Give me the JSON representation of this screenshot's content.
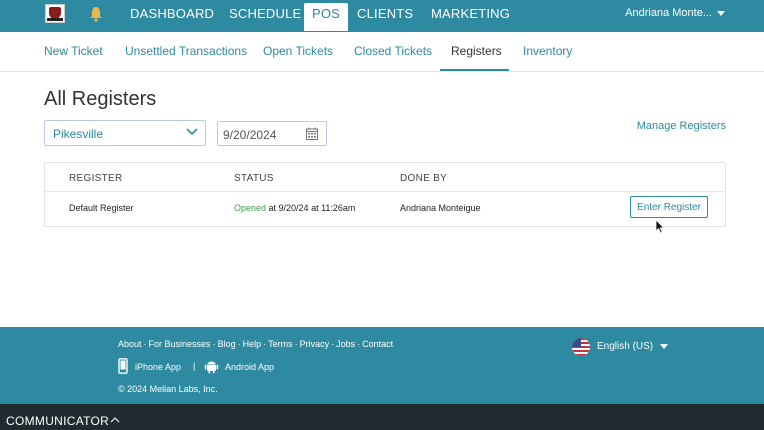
{
  "nav": {
    "items": [
      {
        "label": "DASHBOARD",
        "active": false
      },
      {
        "label": "SCHEDULE",
        "active": false
      },
      {
        "label": "POS",
        "active": true
      },
      {
        "label": "CLIENTS",
        "active": false
      },
      {
        "label": "MARKETING",
        "active": false
      }
    ],
    "user": "Andriana Monte..."
  },
  "subnav": {
    "items": [
      {
        "label": "New Ticket"
      },
      {
        "label": "Unsettled Transactions"
      },
      {
        "label": "Open Tickets"
      },
      {
        "label": "Closed Tickets"
      },
      {
        "label": "Registers",
        "active": true
      },
      {
        "label": "Inventory"
      }
    ]
  },
  "page": {
    "title": "All Registers",
    "location_value": "Pikesville",
    "date_value": "9/20/2024",
    "manage_link": "Manage Registers"
  },
  "table": {
    "headers": [
      "REGISTER",
      "STATUS",
      "DONE BY"
    ],
    "rows": [
      {
        "register": "Default Register",
        "status_word": "Opened",
        "status_rest": " at 9/20/24 at 11:26am",
        "done_by": "Andriana Monteigue",
        "action": "Enter Register"
      }
    ]
  },
  "footer": {
    "links": [
      "About",
      "For Businesses",
      "Blog",
      "Help",
      "Terms",
      "Privacy",
      "Jobs",
      "Contact"
    ],
    "separator": "·",
    "iphone_app": "iPhone App",
    "app_separator": "|",
    "android_app": "Android App",
    "copyright": "© 2024 Melian Labs, Inc.",
    "language": "English (US)"
  },
  "communicator": {
    "label": "COMMUNICATOR"
  },
  "colors": {
    "brand": "#2e8aa0",
    "opened": "#3aa24a",
    "commbar": "#1f2b2e"
  }
}
